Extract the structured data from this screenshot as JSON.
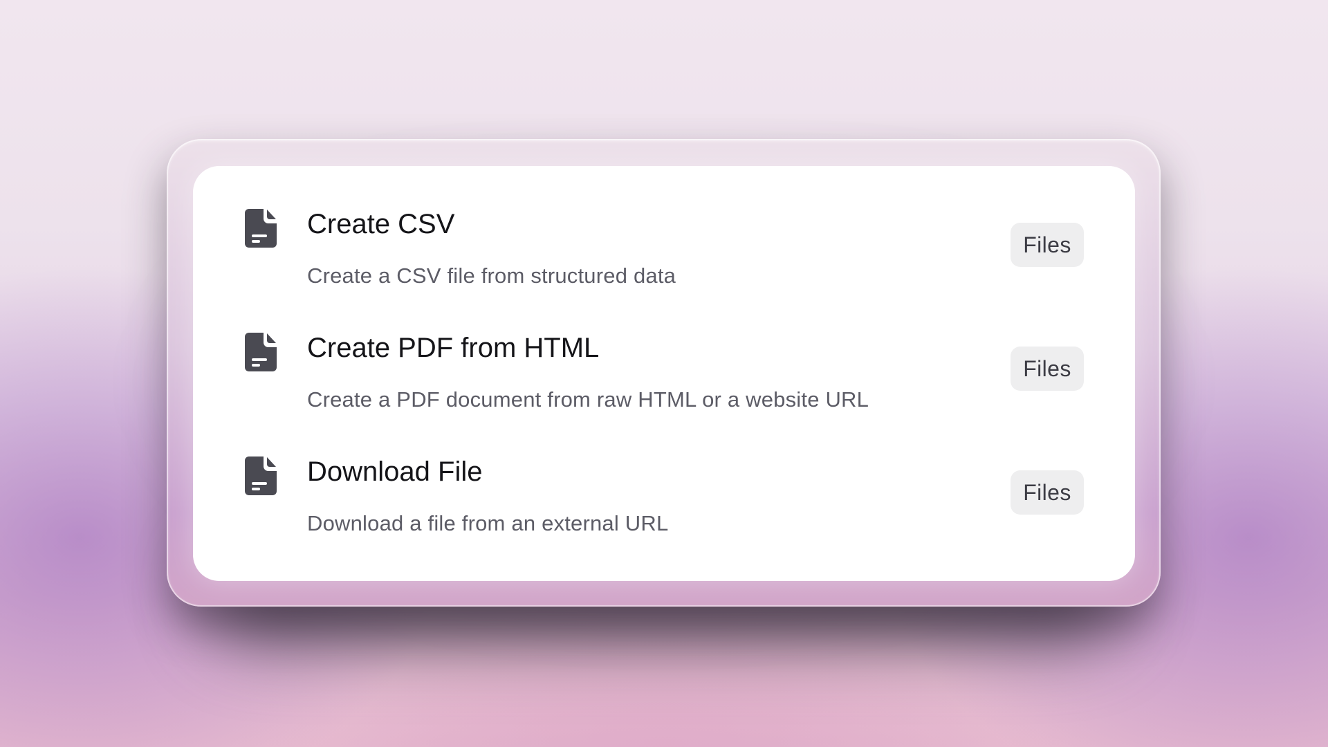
{
  "actions": [
    {
      "icon": "document-icon",
      "title": "Create CSV",
      "description": "Create a CSV file from structured data",
      "category": "Files"
    },
    {
      "icon": "document-icon",
      "title": "Create PDF from HTML",
      "description": "Create a PDF document from raw HTML or a website URL",
      "category": "Files"
    },
    {
      "icon": "document-icon",
      "title": "Download File",
      "description": "Download a file from an external URL",
      "category": "Files"
    }
  ],
  "colors": {
    "icon": "#4a4a52",
    "title": "#141418",
    "description": "#5c5c66",
    "tag_background": "#eeeeef",
    "tag_text": "#3c3c44",
    "card_background": "#ffffff"
  }
}
